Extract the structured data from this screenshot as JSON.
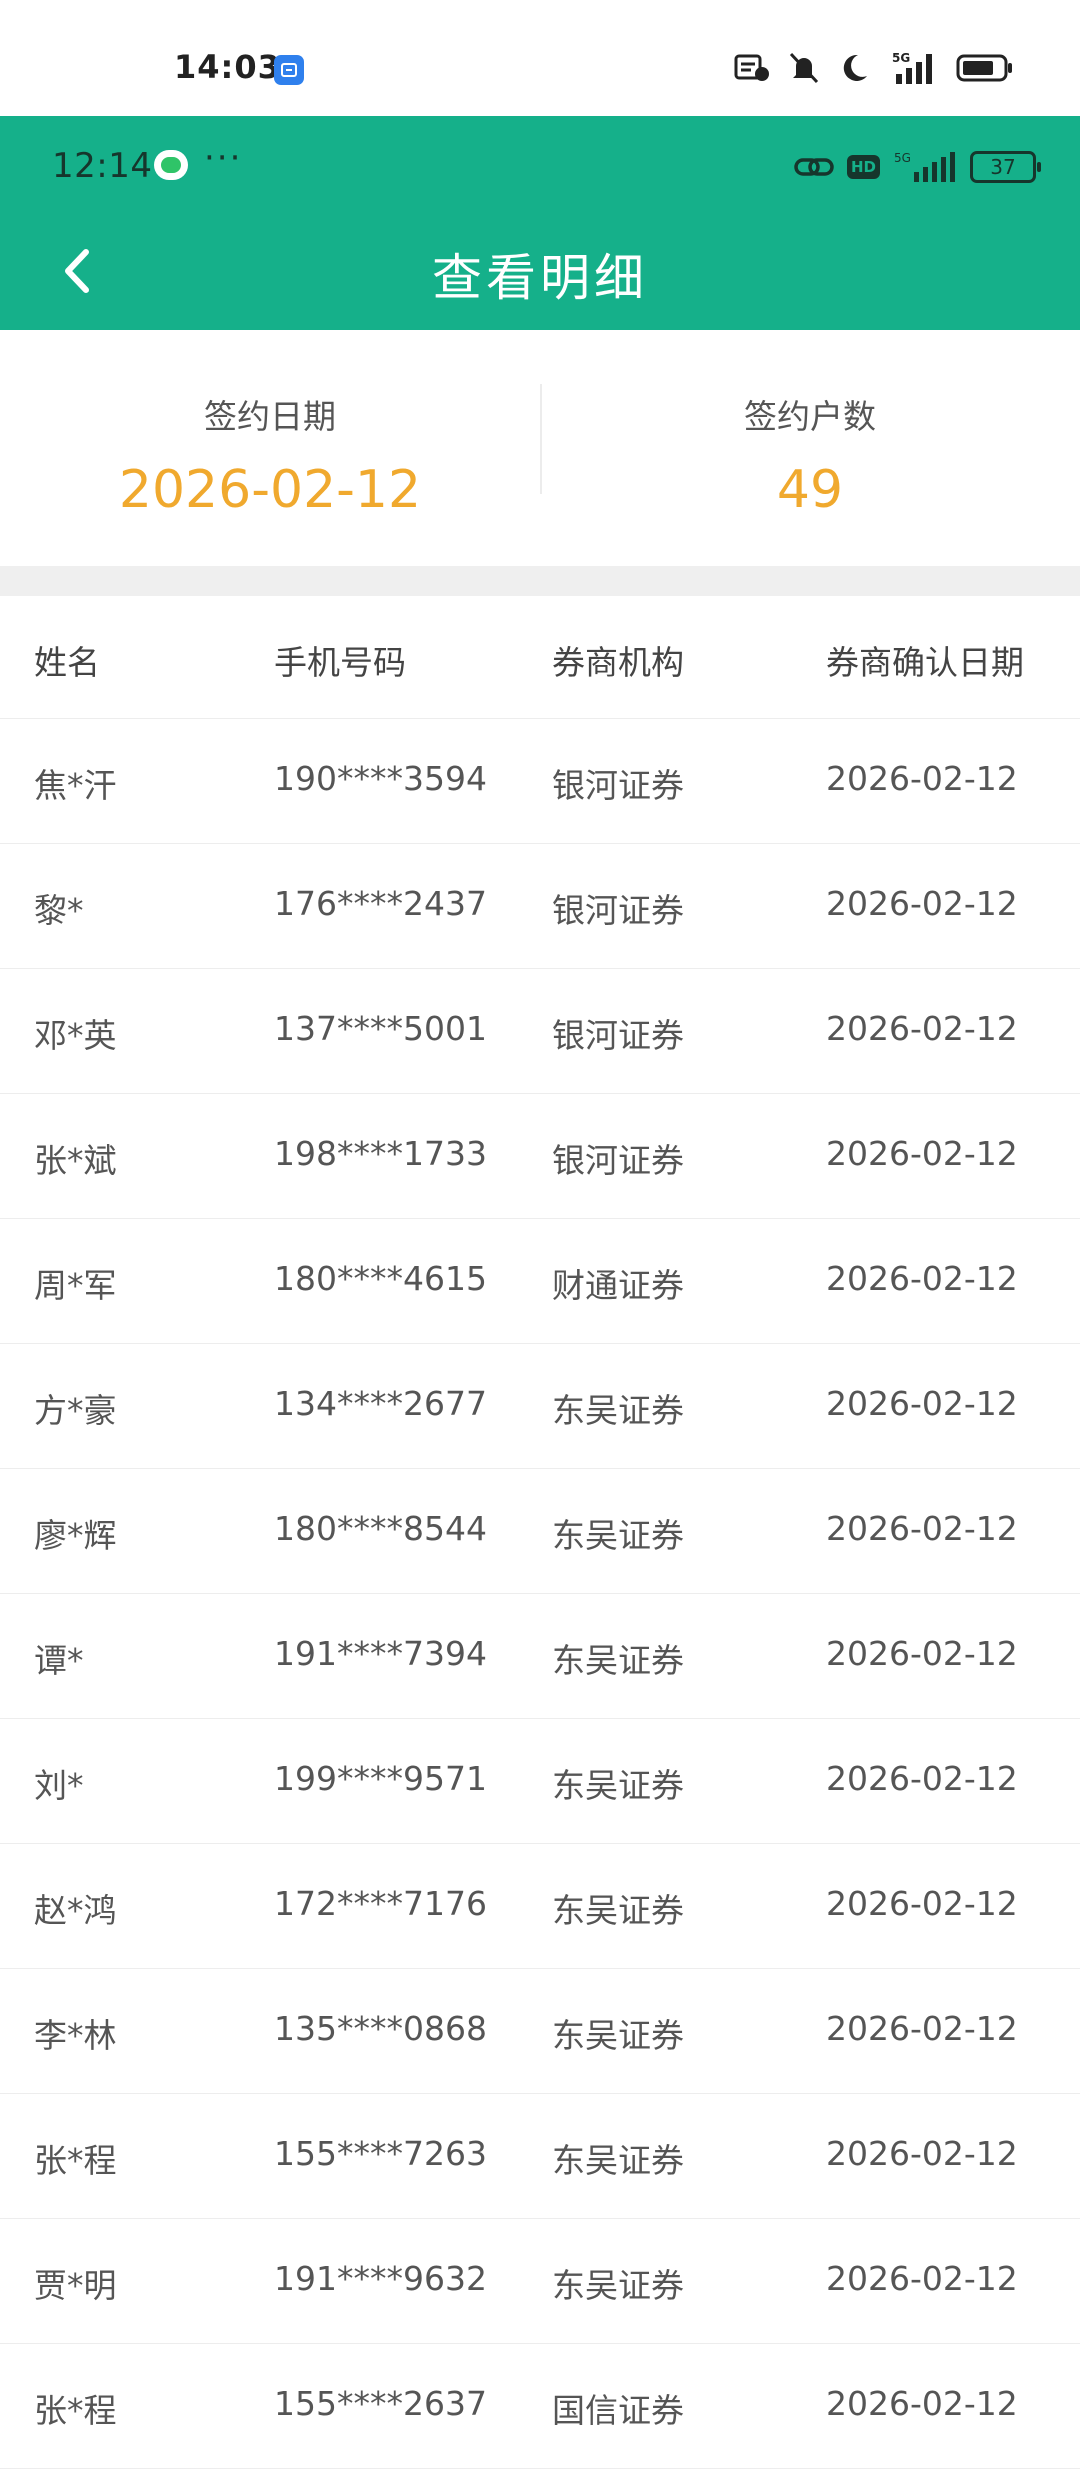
{
  "outer_status": {
    "time": "14:03",
    "network": "5G"
  },
  "inner_status": {
    "time": "12:14",
    "more": "···",
    "hd": "HD",
    "network": "5G",
    "battery": "37"
  },
  "header": {
    "title": "查看明细"
  },
  "summary": {
    "date_label": "签约日期",
    "date_value": "2026-02-12",
    "count_label": "签约户数",
    "count_value": "49"
  },
  "table": {
    "columns": [
      "姓名",
      "手机号码",
      "券商机构",
      "券商确认日期"
    ],
    "rows": [
      [
        "焦*汗",
        "190****3594",
        "银河证券",
        "2026-02-12"
      ],
      [
        "黎*",
        "176****2437",
        "银河证券",
        "2026-02-12"
      ],
      [
        "邓*英",
        "137****5001",
        "银河证券",
        "2026-02-12"
      ],
      [
        "张*斌",
        "198****1733",
        "银河证券",
        "2026-02-12"
      ],
      [
        "周*军",
        "180****4615",
        "财通证券",
        "2026-02-12"
      ],
      [
        "方*豪",
        "134****2677",
        "东吴证券",
        "2026-02-12"
      ],
      [
        "廖*辉",
        "180****8544",
        "东吴证券",
        "2026-02-12"
      ],
      [
        "谭*",
        "191****7394",
        "东吴证券",
        "2026-02-12"
      ],
      [
        "刘*",
        "199****9571",
        "东吴证券",
        "2026-02-12"
      ],
      [
        "赵*鸿",
        "172****7176",
        "东吴证券",
        "2026-02-12"
      ],
      [
        "李*林",
        "135****0868",
        "东吴证券",
        "2026-02-12"
      ],
      [
        "张*程",
        "155****7263",
        "东吴证券",
        "2026-02-12"
      ],
      [
        "贾*明",
        "191****9632",
        "东吴证券",
        "2026-02-12"
      ],
      [
        "张*程",
        "155****2637",
        "国信证券",
        "2026-02-12"
      ]
    ]
  },
  "colors": {
    "header_bg": "#15b08a",
    "accent": "#f0a92e"
  }
}
